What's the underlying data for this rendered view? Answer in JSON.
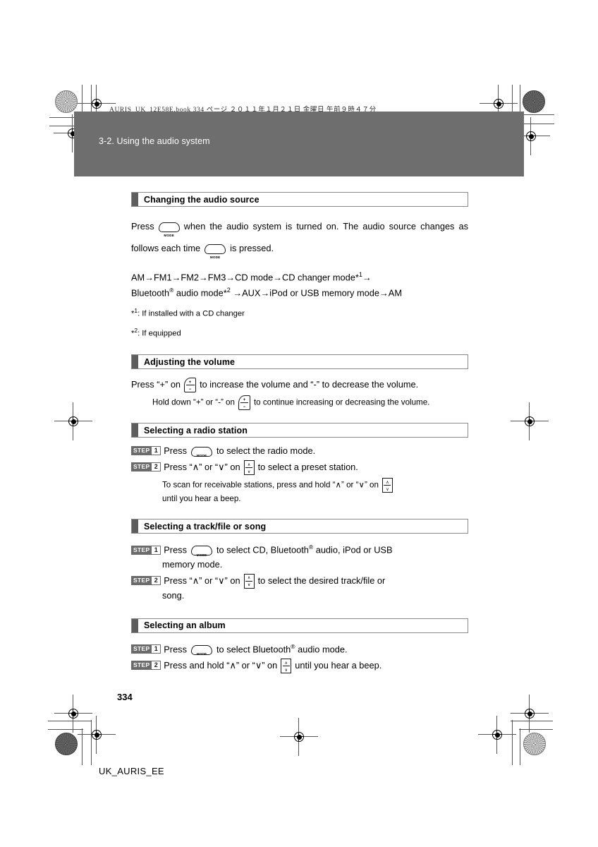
{
  "print_marks": {
    "book_note": "AURIS_UK_12E58E.book    334 ページ    ２０１１年１月２１日    金曜日    午前９時４７分"
  },
  "header": {
    "chapter": "3-2. Using the audio system"
  },
  "sections": [
    {
      "id": "changing-the-audio-source",
      "title": "Changing the audio source",
      "paragraph_1a": "Press",
      "paragraph_1b": "when the audio system is turned on. The audio source",
      "paragraph_1c": "changes as follows each time",
      "paragraph_1d": "is pressed.",
      "flow_line_1": "AM→FM1→FM2→FM3→CD mode→CD changer mode*",
      "flow_line_1_sup": "1",
      "flow_line_1_end": "→",
      "flow_line_2a": "Bluetooth",
      "flow_line_2_regmark": "®",
      "flow_line_2b": " audio mode*",
      "flow_line_2_sup": "2",
      "flow_line_2c": " →AUX→iPod or USB memory mode→AM",
      "footnote_1_star": "*",
      "footnote_1_sup": "1",
      "footnote_1_text": ": If installed with a CD changer",
      "footnote_2_star": "*",
      "footnote_2_sup": "2",
      "footnote_2_text": ": If equipped"
    },
    {
      "id": "adjusting-the-volume",
      "title": "Adjusting the volume",
      "paragraph_a": "Press “+” on",
      "paragraph_b": "to increase the volume and “-” to decrease the volume.",
      "sub_a": "Hold down “+” or “-” on",
      "sub_b": "to continue increasing or decreasing the volume."
    },
    {
      "id": "selecting-a-radio-station",
      "title": "Selecting a radio station",
      "step1_word": "STEP",
      "step1_num": "1",
      "step1_a": "Press",
      "step1_b": "to select the radio mode.",
      "step2_word": "STEP",
      "step2_num": "2",
      "step2_a": "Press “∧” or “∨” on",
      "step2_b": "to select a preset station.",
      "sub_a": "To scan for receivable stations, press and hold “∧” or “∨” on",
      "sub_b": "until you hear a beep."
    },
    {
      "id": "selecting-a-track-file-or-song",
      "title": "Selecting a track/file or song",
      "step1_word": "STEP",
      "step1_num": "1",
      "step1_a": "Press",
      "step1_b": "to select CD, Bluetooth",
      "step1_reg": "®",
      "step1_c": " audio, iPod or USB",
      "step1_hang": "memory mode.",
      "step2_word": "STEP",
      "step2_num": "2",
      "step2_a": "Press “∧” or “∨” on",
      "step2_b": "to select the desired track/file or",
      "step2_hang": "song."
    },
    {
      "id": "selecting-an-album",
      "title": "Selecting an album",
      "step1_word": "STEP",
      "step1_num": "1",
      "step1_a": "Press",
      "step1_b": "to select Bluetooth",
      "step1_reg": "®",
      "step1_c": " audio mode.",
      "step2_word": "STEP",
      "step2_num": "2",
      "step2_a": "Press and hold “∧” or “∨” on",
      "step2_b": "until you hear a beep."
    }
  ],
  "icons": {
    "mode_label": "MODE",
    "volume_plus": "+",
    "volume_minus": "−",
    "seek_up": "∧",
    "seek_down": "∨"
  },
  "footer": {
    "page_number": "334",
    "code": "UK_AURIS_EE"
  },
  "colors": {
    "header_bar": "#6e6e6e",
    "section_tab": "#5e5e5e",
    "step_badge": "#6b6b6b",
    "page_background": "#ffffff"
  }
}
